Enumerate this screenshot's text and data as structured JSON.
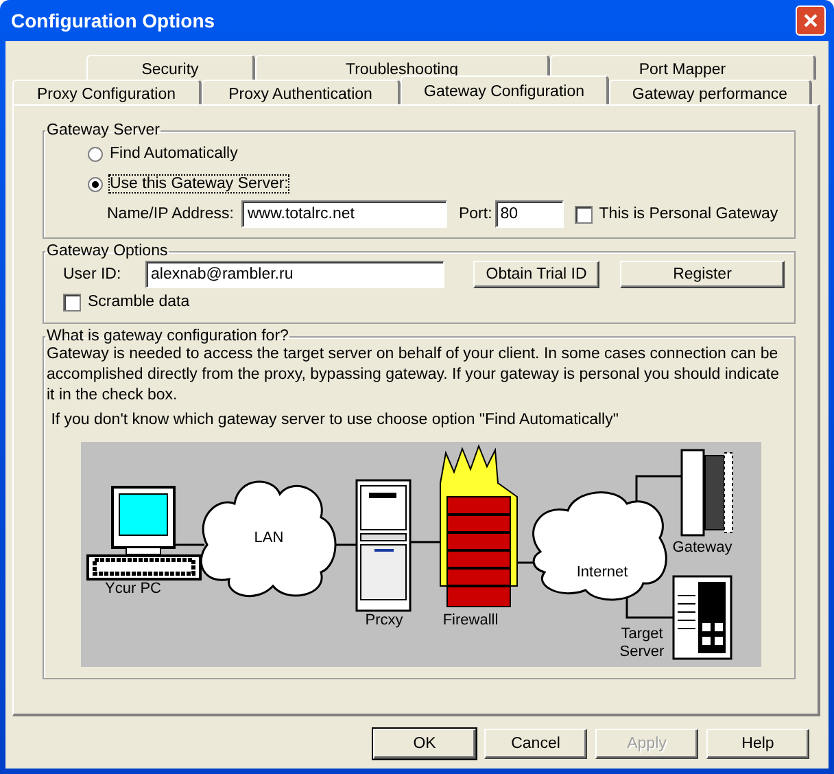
{
  "window": {
    "title": "Configuration Options"
  },
  "tab_rows": [
    {
      "tabs": [
        {
          "label": "Security",
          "selected": false
        },
        {
          "label": "Troubleshooting",
          "selected": false
        },
        {
          "label": "Port Mapper",
          "selected": false
        }
      ]
    },
    {
      "tabs": [
        {
          "label": "Proxy Configuration",
          "selected": false
        },
        {
          "label": "Proxy Authentication",
          "selected": false
        },
        {
          "label": "Gateway Configuration",
          "selected": true
        },
        {
          "label": "Gateway performance",
          "selected": false
        }
      ]
    }
  ],
  "gateway_server": {
    "legend": "Gateway Server",
    "options": [
      {
        "label": "Find Automatically",
        "selected": false
      },
      {
        "label": "Use this Gateway Server:",
        "selected": true
      }
    ],
    "address_label": "Name/IP Address:",
    "address_value": "www.totalrc.net",
    "port_label": "Port:",
    "port_value": "80",
    "personal": {
      "label": "This is Personal Gateway",
      "checked": false
    }
  },
  "gateway_options": {
    "legend": "Gateway Options",
    "user_id_label": "User ID:",
    "user_id_value": "alexnab@rambler.ru",
    "buttons": [
      "Obtain Trial ID",
      "Register"
    ],
    "scramble": {
      "label": "Scramble data",
      "checked": false
    }
  },
  "help": {
    "legend": "What is gateway configuration for?",
    "paragraphs": [
      "Gateway is needed to access the target server on behalf of your client. In some cases connection can be accomplished directly from the proxy, bypassing gateway. If your gateway is personal you should indicate it in the check box.",
      " If you don't know which gateway server to use choose option \"Find Automatically\""
    ],
    "diagram_labels": [
      "Ycur PC",
      "LAN",
      "Prcxy",
      "Firewalll",
      "Internet",
      "Gateway",
      "Target Server"
    ]
  },
  "buttons": [
    {
      "label": "OK",
      "default": true,
      "disabled": false
    },
    {
      "label": "Cancel",
      "default": false,
      "disabled": false
    },
    {
      "label": "Apply",
      "default": false,
      "disabled": true
    },
    {
      "label": "Help",
      "default": false,
      "disabled": false
    }
  ]
}
